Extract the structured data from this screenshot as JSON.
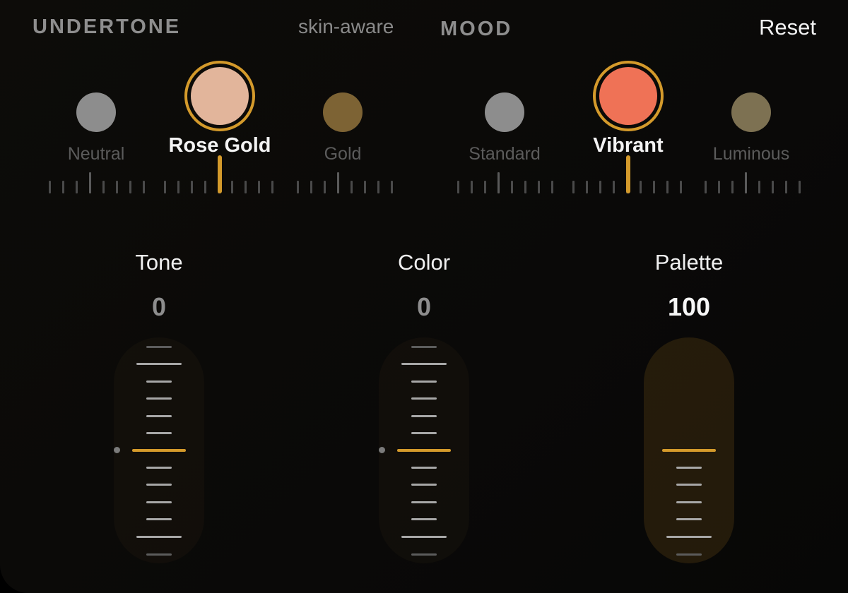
{
  "header": {
    "undertone_title": "UNDERTONE",
    "hint": "skin-aware",
    "mood_title": "MOOD",
    "reset_label": "Reset"
  },
  "undertone": {
    "options": [
      {
        "label": "Neutral",
        "color": "#8d8d8d",
        "selected": false
      },
      {
        "label": "Rose Gold",
        "color": "#e2b59b",
        "selected": true
      },
      {
        "label": "Gold",
        "color": "#7d6334",
        "selected": false
      }
    ]
  },
  "mood": {
    "options": [
      {
        "label": "Standard",
        "color": "#8d8d8d",
        "selected": false
      },
      {
        "label": "Vibrant",
        "color": "#ef7256",
        "selected": true
      },
      {
        "label": "Luminous",
        "color": "#7d7152",
        "selected": false
      }
    ]
  },
  "sliders": [
    {
      "title": "Tone",
      "value": "0",
      "active": false
    },
    {
      "title": "Color",
      "value": "0",
      "active": false
    },
    {
      "title": "Palette",
      "value": "100",
      "active": true
    }
  ],
  "colors": {
    "accent": "#d49a2b"
  }
}
